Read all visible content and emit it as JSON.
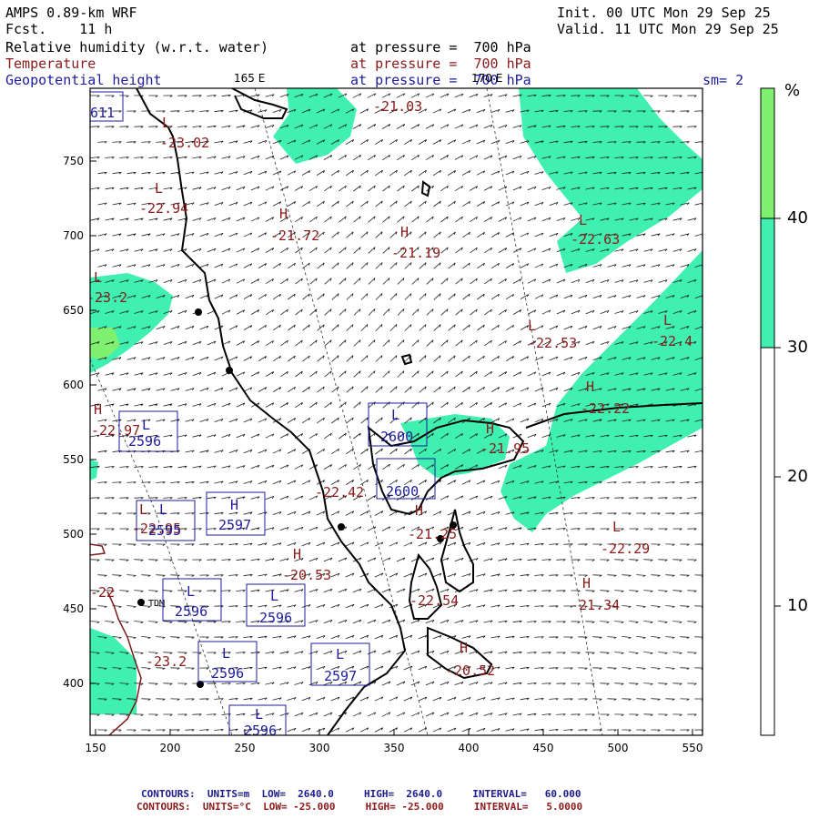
{
  "header": {
    "model": "AMPS 0.89-km WRF",
    "forecast": "Fcst.    11 h",
    "init": "Init. 00 UTC Mon 29 Sep 25",
    "valid": "Valid. 11 UTC Mon 29 Sep 25",
    "field1_name": "Relative humidity (w.r.t. water)",
    "field1_level": "at pressure =  700 hPa",
    "field2_name": "Temperature",
    "field2_level": "at pressure =  700 hPa",
    "field3_name": "Geopotential height",
    "field3_level": "at pressure =  700 hPa",
    "smoothing": "sm= 2",
    "lon_label_1": "165 E",
    "lon_label_2": "170 E"
  },
  "axes": {
    "x_ticks": [
      "150",
      "200",
      "250",
      "300",
      "350",
      "400",
      "450",
      "500",
      "550"
    ],
    "y_ticks": [
      "750",
      "700",
      "650",
      "600",
      "550",
      "500",
      "450",
      "400"
    ]
  },
  "colorbar": {
    "unit": "%",
    "labels": [
      "40",
      "30",
      "20",
      "10"
    ],
    "colors": {
      "band_30_40": "#3ff0b0",
      "band_40_plus": "#80f070",
      "below_30": "#ffffff"
    }
  },
  "temperature_labels": [
    {
      "type": "L",
      "value": "-23.02"
    },
    {
      "type": "",
      "value": "-21.03"
    },
    {
      "type": "L",
      "value": "-22.94"
    },
    {
      "type": "H",
      "value": "-21.72"
    },
    {
      "type": "H",
      "value": "-21.19"
    },
    {
      "type": "L",
      "value": "-22.63"
    },
    {
      "type": "L",
      "value": "-23.2"
    },
    {
      "type": "L",
      "value": "-22.53"
    },
    {
      "type": "L",
      "value": "-22.4"
    },
    {
      "type": "H",
      "value": "-22.97"
    },
    {
      "type": "H",
      "value": "-22.22"
    },
    {
      "type": "H",
      "value": "-21.95"
    },
    {
      "type": "",
      "value": "-22.42"
    },
    {
      "type": "H",
      "value": "-21.25"
    },
    {
      "type": "L",
      "value": "-22.95"
    },
    {
      "type": "L",
      "value": "-22.29"
    },
    {
      "type": "H",
      "value": "-20.53"
    },
    {
      "type": "",
      "value": "-22.54"
    },
    {
      "type": "H",
      "value": "-21.34"
    },
    {
      "type": "",
      "value": "-22"
    },
    {
      "type": "",
      "value": "-23.2"
    },
    {
      "type": "H",
      "value": "-20.52"
    }
  ],
  "height_labels": [
    {
      "type": "",
      "value": "611"
    },
    {
      "type": "L",
      "value": "2596"
    },
    {
      "type": "L",
      "value": "2600"
    },
    {
      "type": "",
      "value": "2600"
    },
    {
      "type": "L",
      "value": "2595"
    },
    {
      "type": "H",
      "value": "2597"
    },
    {
      "type": "L",
      "value": "2596"
    },
    {
      "type": "L",
      "value": "2596"
    },
    {
      "type": "L",
      "value": "2596"
    },
    {
      "type": "L",
      "value": "2597"
    },
    {
      "type": "L",
      "value": "2596"
    }
  ],
  "stations": [
    {
      "name": "TDM"
    }
  ],
  "footer": {
    "line1": "CONTOURS:  UNITS=m  LOW=  2640.0     HIGH=  2640.0     INTERVAL=   60.000",
    "line2": "CONTOURS:  UNITS=°C  LOW= -25.000     HIGH= -25.000     INTERVAL=   5.0000"
  }
}
